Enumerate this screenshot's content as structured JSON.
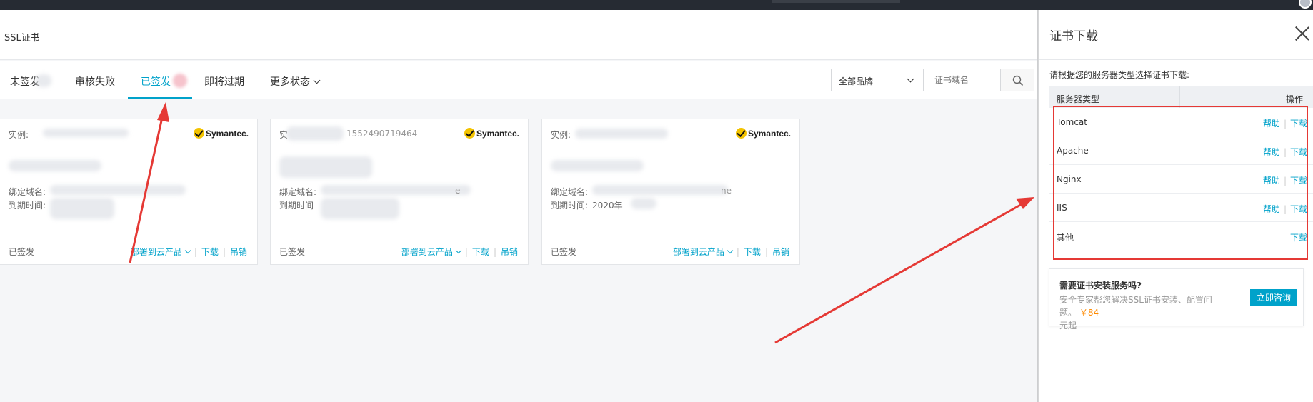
{
  "page": {
    "title": "SSL证书"
  },
  "tabs": [
    {
      "label": "未签发"
    },
    {
      "label": "审核失败"
    },
    {
      "label": "已签发"
    },
    {
      "label": "即将过期"
    },
    {
      "label": "更多状态"
    }
  ],
  "filters": {
    "brand_value": "全部品牌",
    "domain_placeholder": "证书域名"
  },
  "cards": [
    {
      "instance_label": "实例:",
      "brand": "Symantec.",
      "domain_label": "绑定域名:",
      "expiry_label": "到期时间:",
      "expiry_value": "",
      "status": "已签发",
      "deploy": "部署到云产品",
      "download": "下载",
      "revoke": "吊销"
    },
    {
      "instance_label": "实",
      "instance_value": "1552490719464",
      "brand": "Symantec.",
      "domain_label": "绑定域名:",
      "domain_suffix": "e",
      "expiry_label": "到期时间",
      "status": "已签发",
      "deploy": "部署到云产品",
      "download": "下载",
      "revoke": "吊销"
    },
    {
      "instance_label": "实例:",
      "brand": "Symantec.",
      "domain_label": "绑定域名:",
      "domain_suffix": "ne",
      "expiry_label": "到期时间:",
      "expiry_value": "2020年",
      "status": "已签发",
      "deploy": "部署到云产品",
      "download": "下载",
      "revoke": "吊销"
    }
  ],
  "drawer": {
    "title": "证书下载",
    "hint": "请根据您的服务器类型选择证书下载:",
    "col_server": "服务器类型",
    "col_ops": "操作",
    "rows": [
      {
        "name": "Tomcat",
        "help": "帮助",
        "download": "下载"
      },
      {
        "name": "Apache",
        "help": "帮助",
        "download": "下载"
      },
      {
        "name": "Nginx",
        "help": "帮助",
        "download": "下载"
      },
      {
        "name": "IIS",
        "help": "帮助",
        "download": "下载"
      },
      {
        "name": "其他",
        "download": "下载"
      }
    ],
    "promo": {
      "title": "需要证书安装服务吗?",
      "desc": "安全专家帮您解决SSL证书安装、配置问题。",
      "price": "￥84",
      "unit": "元起",
      "button": "立即咨询"
    }
  },
  "colors": {
    "accent": "#00a2ca",
    "annotation": "#e53935",
    "price": "#ff8a00"
  }
}
